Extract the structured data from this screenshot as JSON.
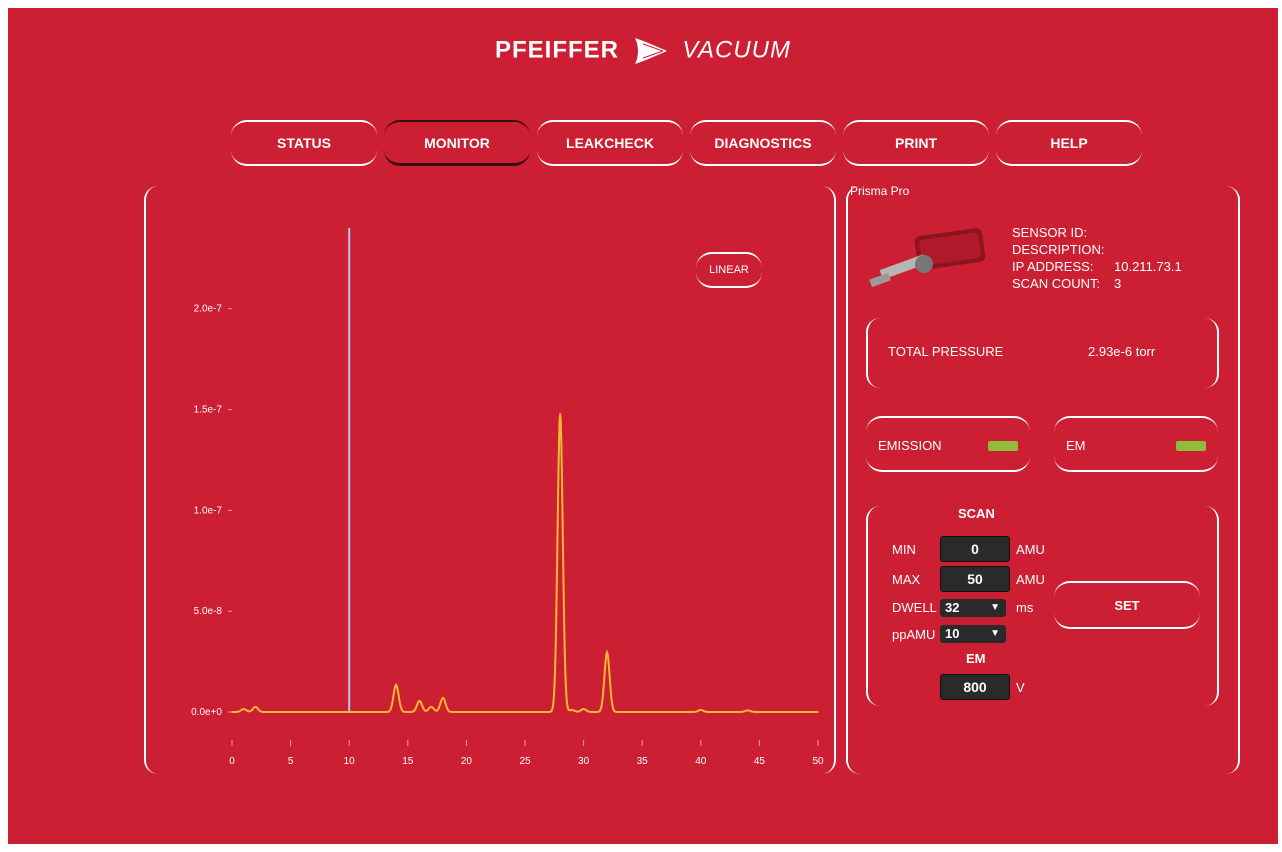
{
  "logo": {
    "brand": "PFEIFFER",
    "suffix": "VACUUM"
  },
  "nav": [
    {
      "label": "STATUS",
      "active": false
    },
    {
      "label": "MONITOR",
      "active": true
    },
    {
      "label": "LEAKCHECK",
      "active": false
    },
    {
      "label": "DIAGNOSTICS",
      "active": false
    },
    {
      "label": "PRINT",
      "active": false
    },
    {
      "label": "HELP",
      "active": false
    }
  ],
  "chart": {
    "scale_button": "LINEAR"
  },
  "chart_data": {
    "type": "line",
    "x": [
      0,
      1,
      2,
      3,
      4,
      5,
      6,
      7,
      8,
      9,
      10,
      11,
      12,
      13,
      14,
      15,
      16,
      17,
      18,
      19,
      20,
      21,
      22,
      23,
      24,
      25,
      26,
      27,
      28,
      29,
      30,
      31,
      32,
      33,
      34,
      35,
      36,
      37,
      38,
      39,
      40,
      41,
      42,
      43,
      44,
      45,
      46,
      47,
      48,
      49,
      50
    ],
    "series": [
      {
        "values": [
          0,
          1.5e-09,
          2.5e-09,
          0,
          0,
          0,
          0,
          0,
          0,
          0,
          0,
          0,
          0,
          0,
          1.35e-08,
          0,
          5.5e-09,
          2.5e-09,
          7e-09,
          0,
          0,
          0,
          0,
          0,
          0,
          0,
          0,
          0,
          1.48e-07,
          1e-09,
          1.5e-09,
          0,
          2.95e-08,
          0,
          0,
          0,
          0,
          0,
          0,
          0,
          1e-09,
          0,
          0,
          0,
          8e-10,
          0,
          0,
          0,
          0,
          0,
          0
        ]
      }
    ],
    "cursor_x": 10,
    "xticks": [
      "0",
      "5",
      "10",
      "15",
      "20",
      "25",
      "30",
      "35",
      "40",
      "45",
      "50"
    ],
    "yticks": [
      "0.0e+0",
      "5.0e-8",
      "1.0e-7",
      "1.5e-7",
      "2.0e-7"
    ],
    "xlim": [
      0,
      50
    ],
    "ylim": [
      0,
      2.4e-07
    ],
    "colors": {
      "line": "#f7b731",
      "cursor": "#b8c4ea"
    }
  },
  "device": {
    "name": "Prisma Pro",
    "info": [
      {
        "key": "SENSOR ID:",
        "value": ""
      },
      {
        "key": "DESCRIPTION:",
        "value": ""
      },
      {
        "key": "IP ADDRESS:",
        "value": "10.211.73.1"
      },
      {
        "key": "SCAN COUNT:",
        "value": "3"
      }
    ],
    "total_pressure_label": "TOTAL PRESSURE",
    "total_pressure_value": "2.93e-6 torr",
    "emission_label": "EMISSION",
    "em_label": "EM",
    "led_color": "#8fbd3a"
  },
  "scan": {
    "title": "SCAN",
    "min_label": "MIN",
    "min_value": "0",
    "min_unit": "AMU",
    "max_label": "MAX",
    "max_value": "50",
    "max_unit": "AMU",
    "dwell_label": "DWELL",
    "dwell_value": "32",
    "dwell_unit": "ms",
    "ppamu_label": "ppAMU",
    "ppamu_value": "10",
    "em_title": "EM",
    "em_value": "800",
    "em_unit": "V",
    "set_button": "SET"
  }
}
